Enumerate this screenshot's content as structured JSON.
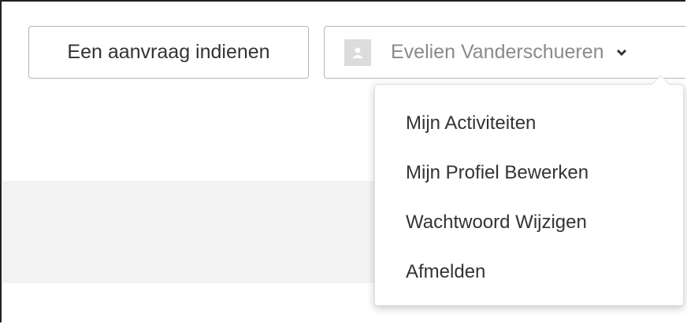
{
  "header": {
    "request_button_label": "Een aanvraag indienen",
    "user_menu": {
      "name": "Evelien Vanderschueren",
      "avatar_icon": "user-avatar-placeholder-icon",
      "toggle_icon": "chevron-down-icon"
    }
  },
  "dropdown": {
    "items": [
      {
        "label": "Mijn Activiteiten"
      },
      {
        "label": "Mijn Profiel Bewerken"
      },
      {
        "label": "Wachtwoord Wijzigen"
      },
      {
        "label": "Afmelden"
      }
    ]
  },
  "colors": {
    "text": "#333333",
    "muted_text": "#8a8a8a",
    "border": "#b5b5b5",
    "band": "#f3f3f3"
  }
}
